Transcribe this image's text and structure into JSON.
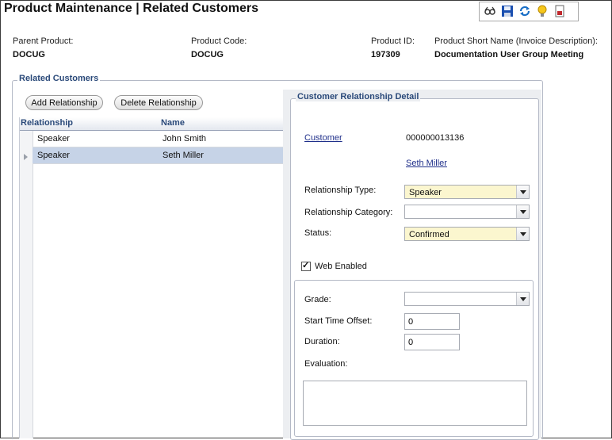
{
  "header": {
    "title": "Product Maintenance  |  Related Customers"
  },
  "toolbar": {
    "icons": [
      "glasses-icon",
      "save-icon",
      "refresh-icon",
      "lightbulb-icon",
      "report-icon"
    ],
    "accent": "#1a6fc6"
  },
  "product": {
    "parent_label": "Parent Product:",
    "parent_value": "DOCUG",
    "code_label": "Product Code:",
    "code_value": "DOCUG",
    "id_label": "Product ID:",
    "id_value": "197309",
    "short_label": "Product Short Name (Invoice Description):",
    "short_value": "Documentation User Group Meeting"
  },
  "related": {
    "legend": "Related Customers",
    "add_label": "Add Relationship",
    "delete_label": "Delete Relationship",
    "columns": [
      "Relationship",
      "Name"
    ],
    "rows": [
      {
        "relationship": "Speaker",
        "name": "John Smith"
      },
      {
        "relationship": "Speaker",
        "name": "Seth Miller"
      }
    ]
  },
  "detail": {
    "legend": "Customer Relationship Detail",
    "customer_label": "Customer",
    "customer_id": "000000013136",
    "customer_name": "Seth Miller",
    "relationship_type_label": "Relationship Type:",
    "relationship_type_value": "Speaker",
    "relationship_category_label": "Relationship Category:",
    "relationship_category_value": "",
    "status_label": "Status:",
    "status_value": "Confirmed",
    "web_enabled_label": "Web Enabled",
    "web_enabled": true,
    "grade_label": "Grade:",
    "grade_value": "",
    "start_offset_label": "Start Time Offset:",
    "start_offset_value": "0",
    "duration_label": "Duration:",
    "duration_value": "0",
    "evaluation_label": "Evaluation:",
    "evaluation_value": ""
  }
}
